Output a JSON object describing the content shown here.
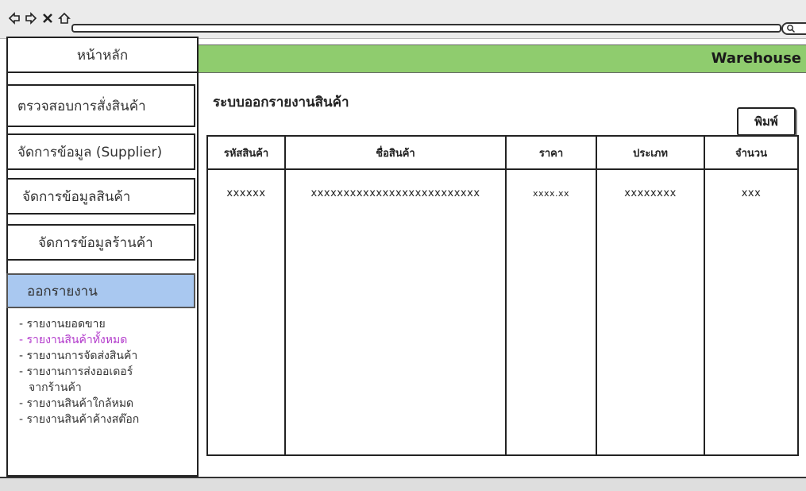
{
  "browser": {
    "icons": [
      "back-arrow-icon",
      "forward-arrow-icon",
      "close-x-icon",
      "home-icon",
      "search-icon"
    ]
  },
  "sidebar": {
    "items": [
      {
        "label": "หน้าหลัก"
      },
      {
        "label": "ตรวจสอบการสั่งสินค้า"
      },
      {
        "label": "จัดการข้อมูล (Supplier)"
      },
      {
        "label": "จัดการข้อมูลสินค้า"
      },
      {
        "label": "จัดการข้อมูลร้านค้า"
      },
      {
        "label": "ออกรายงาน"
      }
    ],
    "submenu": [
      {
        "label": "- รายงานยอดขาย"
      },
      {
        "label": "- รายงานสินค้าทั้งหมด"
      },
      {
        "label": "- รายงานการจัดส่งสินค้า"
      },
      {
        "label": "- รายงานการส่งออเดอร์"
      },
      {
        "label": "จากร้านค้า"
      },
      {
        "label": "- รายงานสินค้าใกล้หมด"
      },
      {
        "label": "- รายงานสินค้าค้างสต๊อก"
      }
    ]
  },
  "header": {
    "brand": "Warehouse"
  },
  "main": {
    "title": "ระบบออกรายงานสินค้า",
    "print_label": "พิมพ์"
  },
  "table": {
    "headers": [
      "รหัสสินค้า",
      "ชื่อสินค้า",
      "ราคา",
      "ประเภท",
      "จำนวน"
    ],
    "rows": [
      [
        "xxxxxx",
        "xxxxxxxxxxxxxxxxxxxxxxxxxx",
        "xxxx.xx",
        "xxxxxxxx",
        "xxx"
      ]
    ]
  },
  "colors": {
    "header_green": "#8fcc6e",
    "active_blue": "#a9c8f0",
    "submenu_highlight": "#b23acb"
  }
}
